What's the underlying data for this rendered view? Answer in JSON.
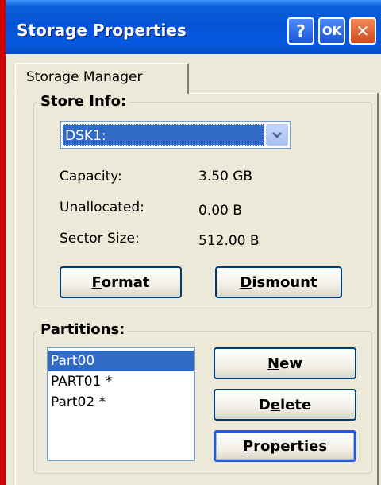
{
  "window": {
    "title": "Storage Properties",
    "help_label": "?",
    "ok_label": "OK",
    "close_label": "✕"
  },
  "tabs": [
    {
      "label": "Storage Manager",
      "active": true
    }
  ],
  "store_info": {
    "title": "Store Info:",
    "store_select": {
      "value": "DSK1:",
      "arrow_icon": "chevron-down-icon"
    },
    "rows": [
      {
        "label": "Capacity:",
        "value": "3.50 GB"
      },
      {
        "label": "Unallocated:",
        "value": "0.00 B"
      },
      {
        "label": "Sector Size:",
        "value": "512.00 B"
      }
    ],
    "format_button": {
      "mnemonic": "F",
      "rest": "ormat"
    },
    "dismount_button": {
      "mnemonic": "D",
      "rest": "ismount"
    }
  },
  "partitions": {
    "title": "Partitions:",
    "items": [
      {
        "label": "Part00",
        "selected": true
      },
      {
        "label": "PART01 *",
        "selected": false
      },
      {
        "label": "Part02 *",
        "selected": false
      }
    ],
    "new_button": {
      "mnemonic": "N",
      "rest": "ew"
    },
    "delete_button": {
      "pre": "D",
      "mnemonic": "e",
      "rest": "lete"
    },
    "properties_button": {
      "mnemonic": "P",
      "rest": "roperties"
    }
  },
  "colors": {
    "titlebar": "#0654d6",
    "selection": "#316ac5",
    "dialog_face": "#ece9d8",
    "left_border": "#d30000",
    "close_button": "#d2491d"
  }
}
